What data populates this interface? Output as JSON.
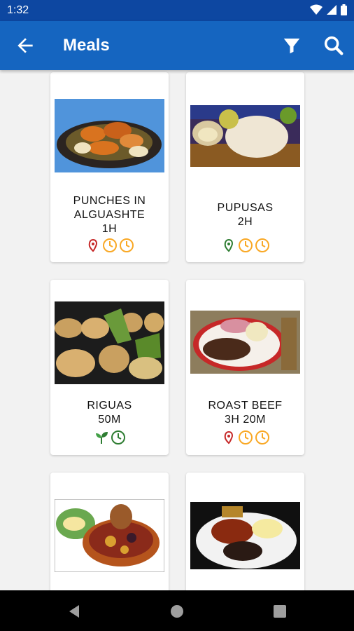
{
  "status": {
    "time": "1:32"
  },
  "app_bar": {
    "title": "Meals"
  },
  "icons": {
    "back": "arrow-left-icon",
    "filter": "filter-icon",
    "search": "search-icon",
    "meat": "meat-icon",
    "veg": "leaf-icon",
    "clock": "clock-icon"
  },
  "colors": {
    "app_bar": "#1565c0",
    "status_bar": "#0d47a1",
    "meat_red": "#c62828",
    "meat_green": "#2e7d32",
    "clock_yellow": "#f9a825",
    "clock_green": "#2e7d32"
  },
  "meals": [
    {
      "name_line1": "PUNCHES IN",
      "name_line2": "ALGUASHTE",
      "time": "1H",
      "badges": [
        "meat-red",
        "clock-yellow",
        "clock-yellow"
      ]
    },
    {
      "name_line1": "PUPUSAS",
      "name_line2": "",
      "time": "2H",
      "badges": [
        "meat-green",
        "clock-yellow",
        "clock-yellow"
      ]
    },
    {
      "name_line1": "RIGUAS",
      "name_line2": "",
      "time": "50M",
      "badges": [
        "leaf-green",
        "clock-green"
      ]
    },
    {
      "name_line1": "ROAST BEEF",
      "name_line2": "",
      "time": "3H 20M",
      "badges": [
        "meat-red",
        "clock-yellow",
        "clock-yellow"
      ]
    },
    {
      "name_line1": "",
      "name_line2": "",
      "time": "",
      "badges": []
    },
    {
      "name_line1": "",
      "name_line2": "",
      "time": "",
      "badges": []
    }
  ]
}
